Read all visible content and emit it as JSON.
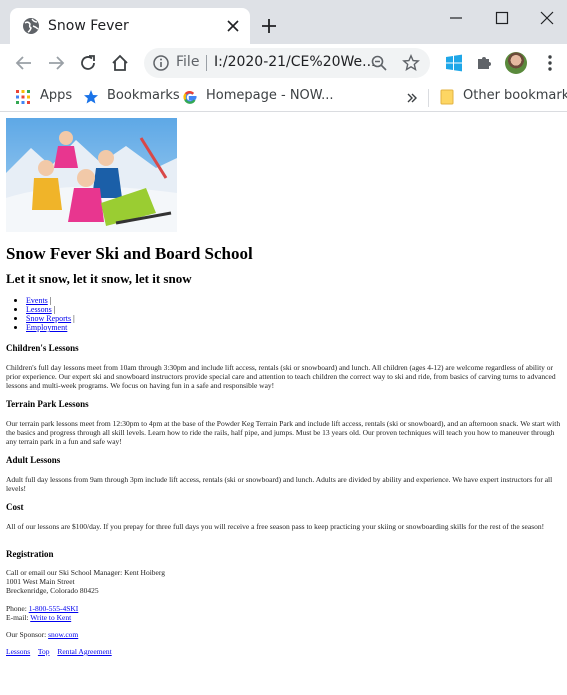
{
  "browser": {
    "tab_title": "Snow Fever",
    "omnibox_scheme": "File",
    "omnibox_url": "I:/2020-21/CE%20We...",
    "bookmarks": {
      "apps": "Apps",
      "bookmarks": "Bookmarks",
      "homepage": "Homepage - NOW...",
      "other": "Other bookmarks"
    },
    "icons": [
      "globe-icon",
      "close-icon",
      "plus-icon",
      "minimize-icon",
      "maximize-icon",
      "window-close-icon",
      "back-arrow-icon",
      "forward-arrow-icon",
      "reload-icon",
      "home-icon",
      "info-icon",
      "zoom-icon",
      "star-icon",
      "windows-icon",
      "puzzle-icon",
      "menu-dots-icon",
      "apps-grid-icon",
      "bookmark-star-icon",
      "google-g-icon",
      "chevron-double-right-icon",
      "folder-icon"
    ],
    "accent_colors": {
      "tabbar": "#dee1e6",
      "omnibox": "#f1f3f4",
      "link": "#0000ee",
      "bookmark_star": "#1a73e8"
    }
  },
  "page": {
    "title": "Snow Fever Ski and Board School",
    "subtitle": "Let it snow, let it snow, let it snow",
    "nav": [
      {
        "label": "Events",
        "sep": " |"
      },
      {
        "label": "Lessons",
        "sep": " |"
      },
      {
        "label": "Snow Reports",
        "sep": " |"
      },
      {
        "label": "Employment",
        "sep": ""
      }
    ],
    "sections": [
      {
        "heading": "Children's Lessons",
        "text": "Children's full day lessons meet from 10am through 3:30pm and include lift access, rentals (ski or snowboard) and lunch. All children (ages 4-12) are welcome regardless of ability or prior experience. Our expert ski and snowboard instructors provide special care and attention to teach children the correct way to ski and ride, from basics of carving turns to advanced lessons and multi-week programs. We focus on having fun in a safe and responsible way!"
      },
      {
        "heading": "Terrain Park Lessons",
        "text": "Our terrain park lessons meet from 12:30pm to 4pm at the base of the Powder Keg Terrain Park and include lift access, rentals (ski or snowboard), and an afternoon snack. We start with the basics and progress through all skill levels. Learn how to ride the rails, half pipe, and jumps. Must be 13 years old. Our proven techniques will teach you how to maneuver through any terrain park in a fun and safe way!"
      },
      {
        "heading": "Adult Lessons",
        "text": "Adult full day lessons from 9am through 3pm include lift access, rentals (ski or snowboard) and lunch. Adults are divided by ability and experience. We have expert instructors for all levels!"
      },
      {
        "heading": "Cost",
        "text": "All of our lessons are $100/day. If you prepay for three full days you will receive a free season pass to keep practicing your skiing or snowboarding skills for the rest of the season!"
      }
    ],
    "registration": {
      "heading": "Registration",
      "line1": "Call or email our Ski School Manager: Kent Hoiberg",
      "line2": "1001 West Main Street",
      "line3": "Breckenridge, Colorado 80425",
      "phone_label": "Phone: ",
      "phone": "1-800-555-4SKI",
      "email_label": "E-mail: ",
      "email": "Write to Kent",
      "sponsor_label": "Our Sponsor: ",
      "sponsor": "snow.com"
    },
    "footer_links": [
      "Lessons",
      "Top",
      "Rental Agreement"
    ]
  }
}
